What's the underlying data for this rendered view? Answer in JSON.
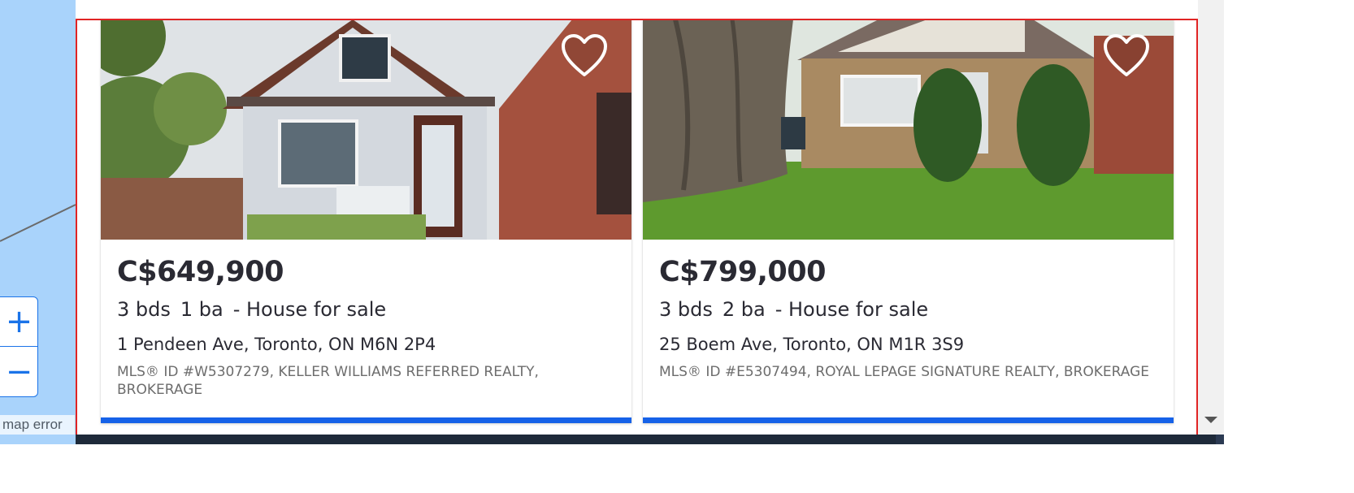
{
  "map": {
    "zoom_in_label": "+",
    "zoom_out_label": "−",
    "error_text": "map error",
    "background_color": "#a9d3fb"
  },
  "listings": [
    {
      "price": "C$649,900",
      "beds": "3 bds",
      "baths": "1 ba",
      "type": "- House for sale",
      "address": "1 Pendeen Ave, Toronto, ON M6N 2P4",
      "mls": "MLS® ID #W5307279, KELLER WILLIAMS REFERRED REALTY, BROKERAGE",
      "photo_icon": "house-photo",
      "favorite_icon": "heart-outline-icon"
    },
    {
      "price": "C$799,000",
      "beds": "3 bds",
      "baths": "2 ba",
      "type": "- House for sale",
      "address": "25 Boem Ave, Toronto, ON M1R 3S9",
      "mls": "MLS® ID #E5307494, ROYAL LEPAGE SIGNATURE REALTY, BROKERAGE",
      "photo_icon": "house-photo",
      "favorite_icon": "heart-outline-icon"
    }
  ],
  "colors": {
    "accent": "#1662e8",
    "selection": "#e02424",
    "text": "#2a2a33"
  }
}
